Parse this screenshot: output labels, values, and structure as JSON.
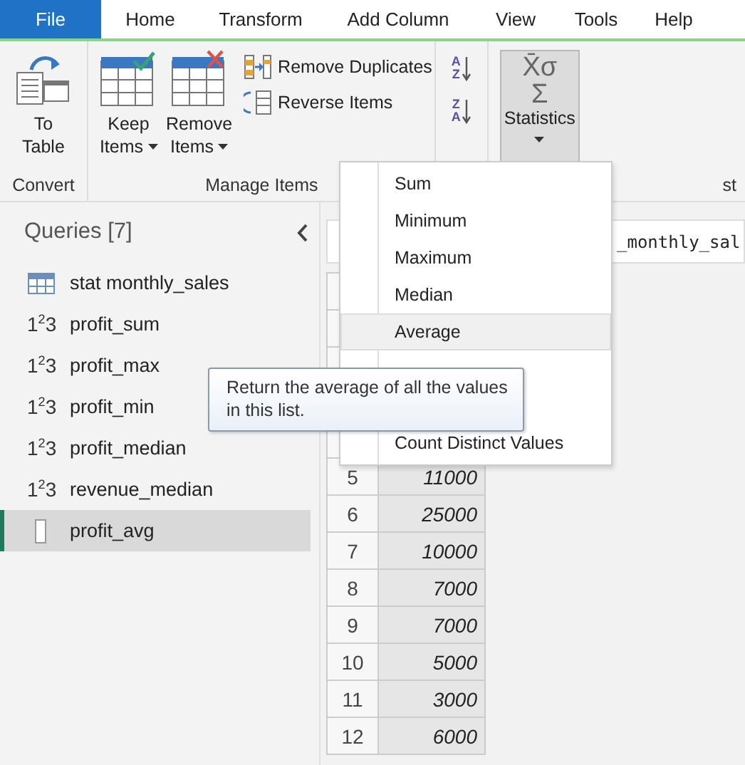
{
  "tabs": [
    {
      "label": "File",
      "selected": true
    },
    {
      "label": "Home",
      "selected": false
    },
    {
      "label": "Transform",
      "selected": false
    },
    {
      "label": "Add Column",
      "selected": false
    },
    {
      "label": "View",
      "selected": false
    },
    {
      "label": "Tools",
      "selected": false
    },
    {
      "label": "Help",
      "selected": false
    }
  ],
  "ribbon": {
    "to_table": [
      "To",
      "Table"
    ],
    "keep_items": [
      "Keep",
      "Items"
    ],
    "remove_items": [
      "Remove",
      "Items"
    ],
    "remove_duplicates": "Remove Duplicates",
    "reverse_items": "Reverse Items",
    "sort_buttons": [
      {
        "top": "A",
        "bottom": "Z"
      },
      {
        "top": "Z",
        "bottom": "A"
      }
    ],
    "statistics": {
      "label": "Statistics",
      "symbols": [
        "X̄σ",
        "Σ"
      ],
      "pressed": true
    },
    "group_labels": [
      "Convert",
      "Manage Items",
      "st"
    ]
  },
  "queries": {
    "title": "Queries [7]",
    "items": [
      {
        "name": "stat monthly_sales",
        "kind": "table",
        "selected": false
      },
      {
        "name": "profit_sum",
        "kind": "number",
        "glyph": "1$^{2}$3",
        "selected": false
      },
      {
        "name": "profit_max",
        "kind": "number",
        "glyph": "1$^{2}$3",
        "selected": false
      },
      {
        "name": "profit_min",
        "kind": "number",
        "glyph": "1$^{2}$3",
        "selected": false
      },
      {
        "name": "profit_median",
        "kind": "number",
        "glyph": "1$^{2}$3",
        "selected": false
      },
      {
        "name": "revenue_median",
        "kind": "number",
        "glyph": "1$^{2}$3",
        "selected": false
      },
      {
        "name": "profit_avg",
        "kind": "list",
        "selected": true
      }
    ]
  },
  "formula_bar": {
    "text": "_monthly_sal"
  },
  "table": {
    "rows": [
      {
        "index": "5",
        "value": "11000"
      },
      {
        "index": "6",
        "value": "25000"
      },
      {
        "index": "7",
        "value": "10000"
      },
      {
        "index": "8",
        "value": "7000"
      },
      {
        "index": "9",
        "value": "7000"
      },
      {
        "index": "10",
        "value": "5000"
      },
      {
        "index": "11",
        "value": "3000"
      },
      {
        "index": "12",
        "value": "6000"
      }
    ]
  },
  "statistics_menu": {
    "items": [
      {
        "label": "Sum",
        "selected": false
      },
      {
        "label": "Minimum",
        "selected": false
      },
      {
        "label": "Maximum",
        "selected": false
      },
      {
        "label": "Median",
        "selected": false
      },
      {
        "label": "Average",
        "selected": true
      },
      {
        "label": "Count Distinct Values",
        "selected": false
      }
    ]
  },
  "tooltip": {
    "text": "Return the average of all the values in this list."
  }
}
